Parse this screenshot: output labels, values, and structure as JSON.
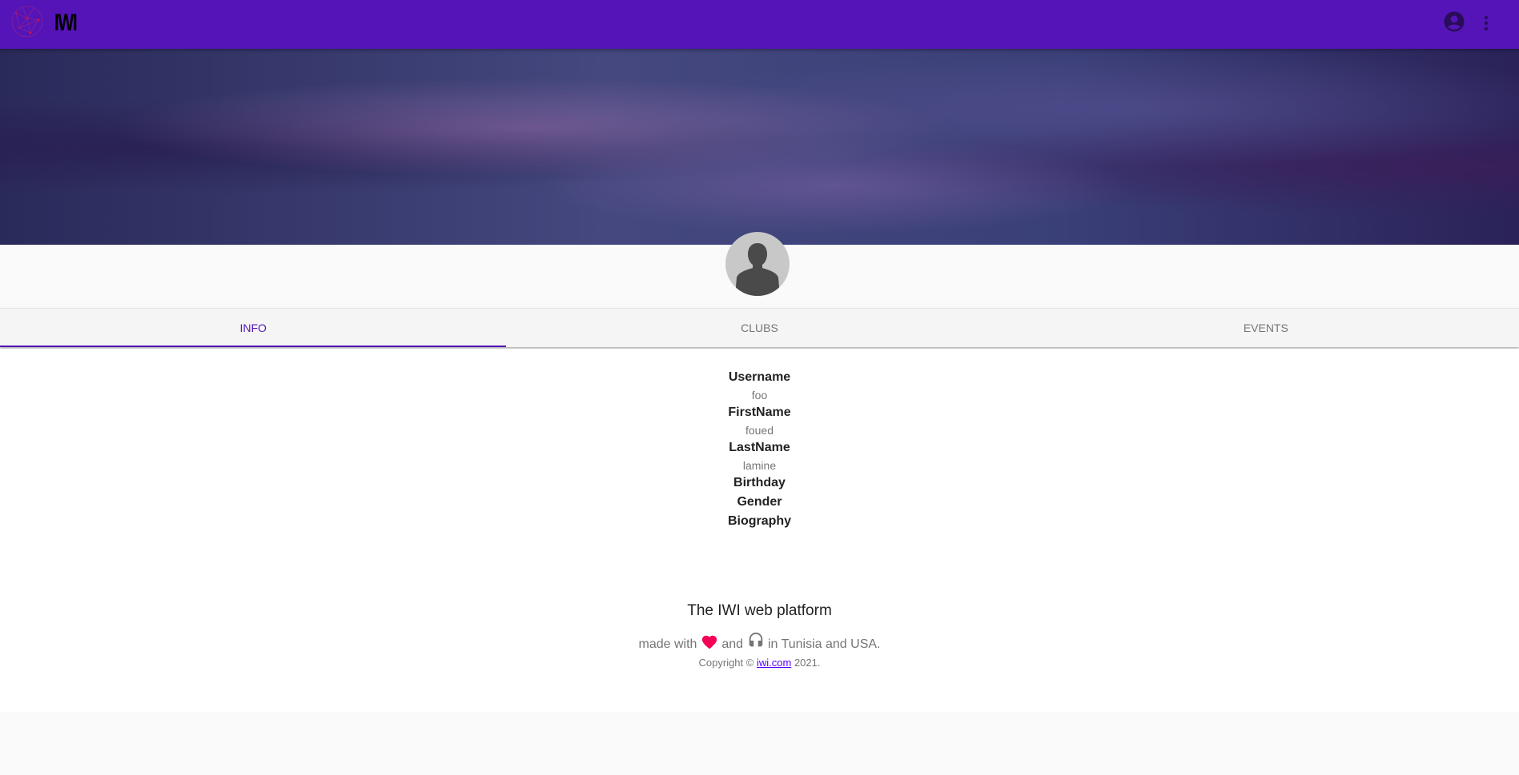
{
  "appbar": {
    "logo_text": "IWI",
    "icons": [
      "globe-logo",
      "account-circle-icon",
      "more-vert-icon"
    ],
    "color": "#5514b8"
  },
  "tabs": [
    {
      "label": "INFO",
      "active": true
    },
    {
      "label": "CLUBS",
      "active": false
    },
    {
      "label": "EVENTS",
      "active": false
    }
  ],
  "info": {
    "username_label": "Username",
    "username": "foo",
    "firstname_label": "FirstName",
    "firstname": "foued",
    "lastname_label": "LastName",
    "lastname": "lamine",
    "birthday_label": "Birthday",
    "gender_label": "Gender",
    "biography_label": "Biography"
  },
  "footer": {
    "title": "The IWI web platform",
    "made_with": "made with",
    "and": "and",
    "location": "in Tunisia and USA.",
    "copyright": "Copyright ©",
    "link": "iwi.com",
    "year": "2021."
  }
}
